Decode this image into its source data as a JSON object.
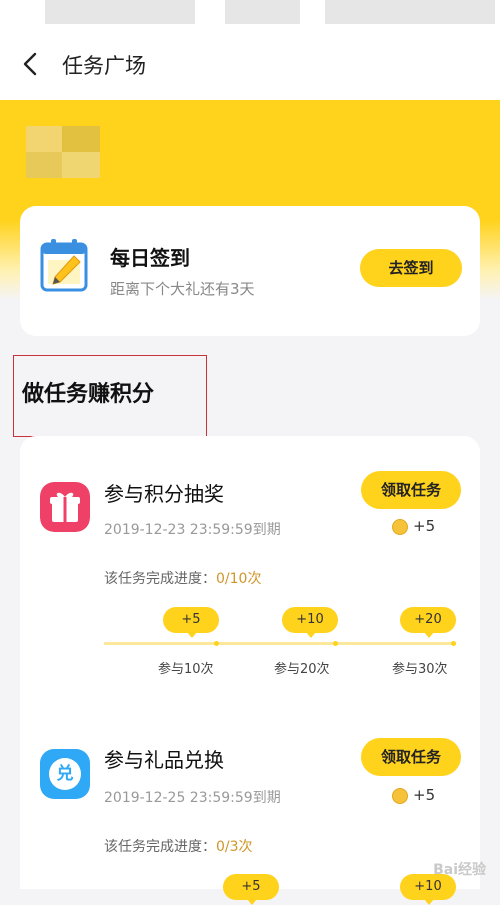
{
  "header": {
    "title": "任务广场"
  },
  "checkin": {
    "title": "每日签到",
    "subtitle": "距离下个大礼还有3天",
    "button_label": "去签到"
  },
  "section": {
    "title": "做任务赚积分"
  },
  "tasks": [
    {
      "title": "参与积分抽奖",
      "deadline": "2019-12-23 23:59:59到期",
      "button_label": "领取任务",
      "reward": "+5",
      "progress_label": "该任务完成进度：",
      "progress_value": "0/10次",
      "progress_fraction": 0,
      "milestones": [
        {
          "reward": "+5",
          "label": "参与10次"
        },
        {
          "reward": "+10",
          "label": "参与20次"
        },
        {
          "reward": "+20",
          "label": "参与30次"
        }
      ]
    },
    {
      "title": "参与礼品兑换",
      "icon_text": "兑",
      "deadline": "2019-12-25 23:59:59到期",
      "button_label": "领取任务",
      "reward": "+5",
      "progress_label": "该任务完成进度：",
      "progress_value": "0/3次",
      "progress_fraction": 0,
      "milestones": [
        {
          "reward": "+5"
        },
        {
          "reward": "+10"
        }
      ]
    }
  ],
  "watermark": "Bai经验",
  "colors": {
    "accent": "#ffd21c",
    "gift_icon": "#ef4067",
    "exchange_icon": "#2fa8f5",
    "highlight_border": "#c8323a"
  },
  "icons": [
    "back-chevron-icon",
    "calendar-pencil-icon",
    "gift-icon",
    "exchange-icon",
    "coin-icon"
  ]
}
